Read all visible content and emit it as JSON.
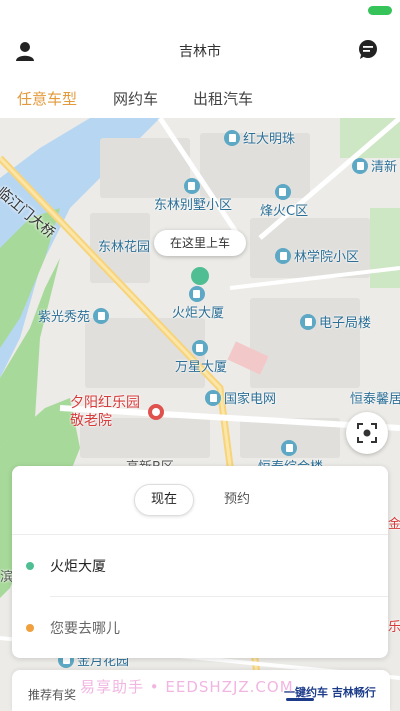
{
  "header": {
    "city": "吉林市"
  },
  "tabs": [
    {
      "label": "任意车型",
      "active": true
    },
    {
      "label": "网约车",
      "active": false
    },
    {
      "label": "出租汽车",
      "active": false
    }
  ],
  "colors": {
    "accent": "#e39a3b",
    "pickup_dot": "#4fbf93",
    "dest_dot": "#f0a03c",
    "poi_blue": "#2c6f96",
    "poi_red": "#d63b3b"
  },
  "map": {
    "pickup_bubble": "在这里上车",
    "road_labels": [
      "临江门大桥"
    ],
    "pois": [
      "红大明珠",
      "清新",
      "东林别墅小区",
      "烽火C区",
      "东林花园",
      "林学院小区",
      "紫光秀苑",
      "火炬大厦",
      "电子局楼",
      "万星大厦",
      "国家电网",
      "恒泰馨居",
      "夕阳红乐园敬老院",
      "高新B区",
      "恒泰综合楼",
      "金月花园",
      "滨",
      "乐",
      "金"
    ]
  },
  "panel": {
    "time_tabs": [
      {
        "label": "现在",
        "selected": true
      },
      {
        "label": "预约",
        "selected": false
      }
    ],
    "pickup": "火炬大厦",
    "destination_placeholder": "您要去哪儿"
  },
  "promo": {
    "label": "推荐有奖",
    "brand": "一键约车 吉林畅行"
  },
  "watermark": "易享助手 • EEDSHZJZ.COM"
}
